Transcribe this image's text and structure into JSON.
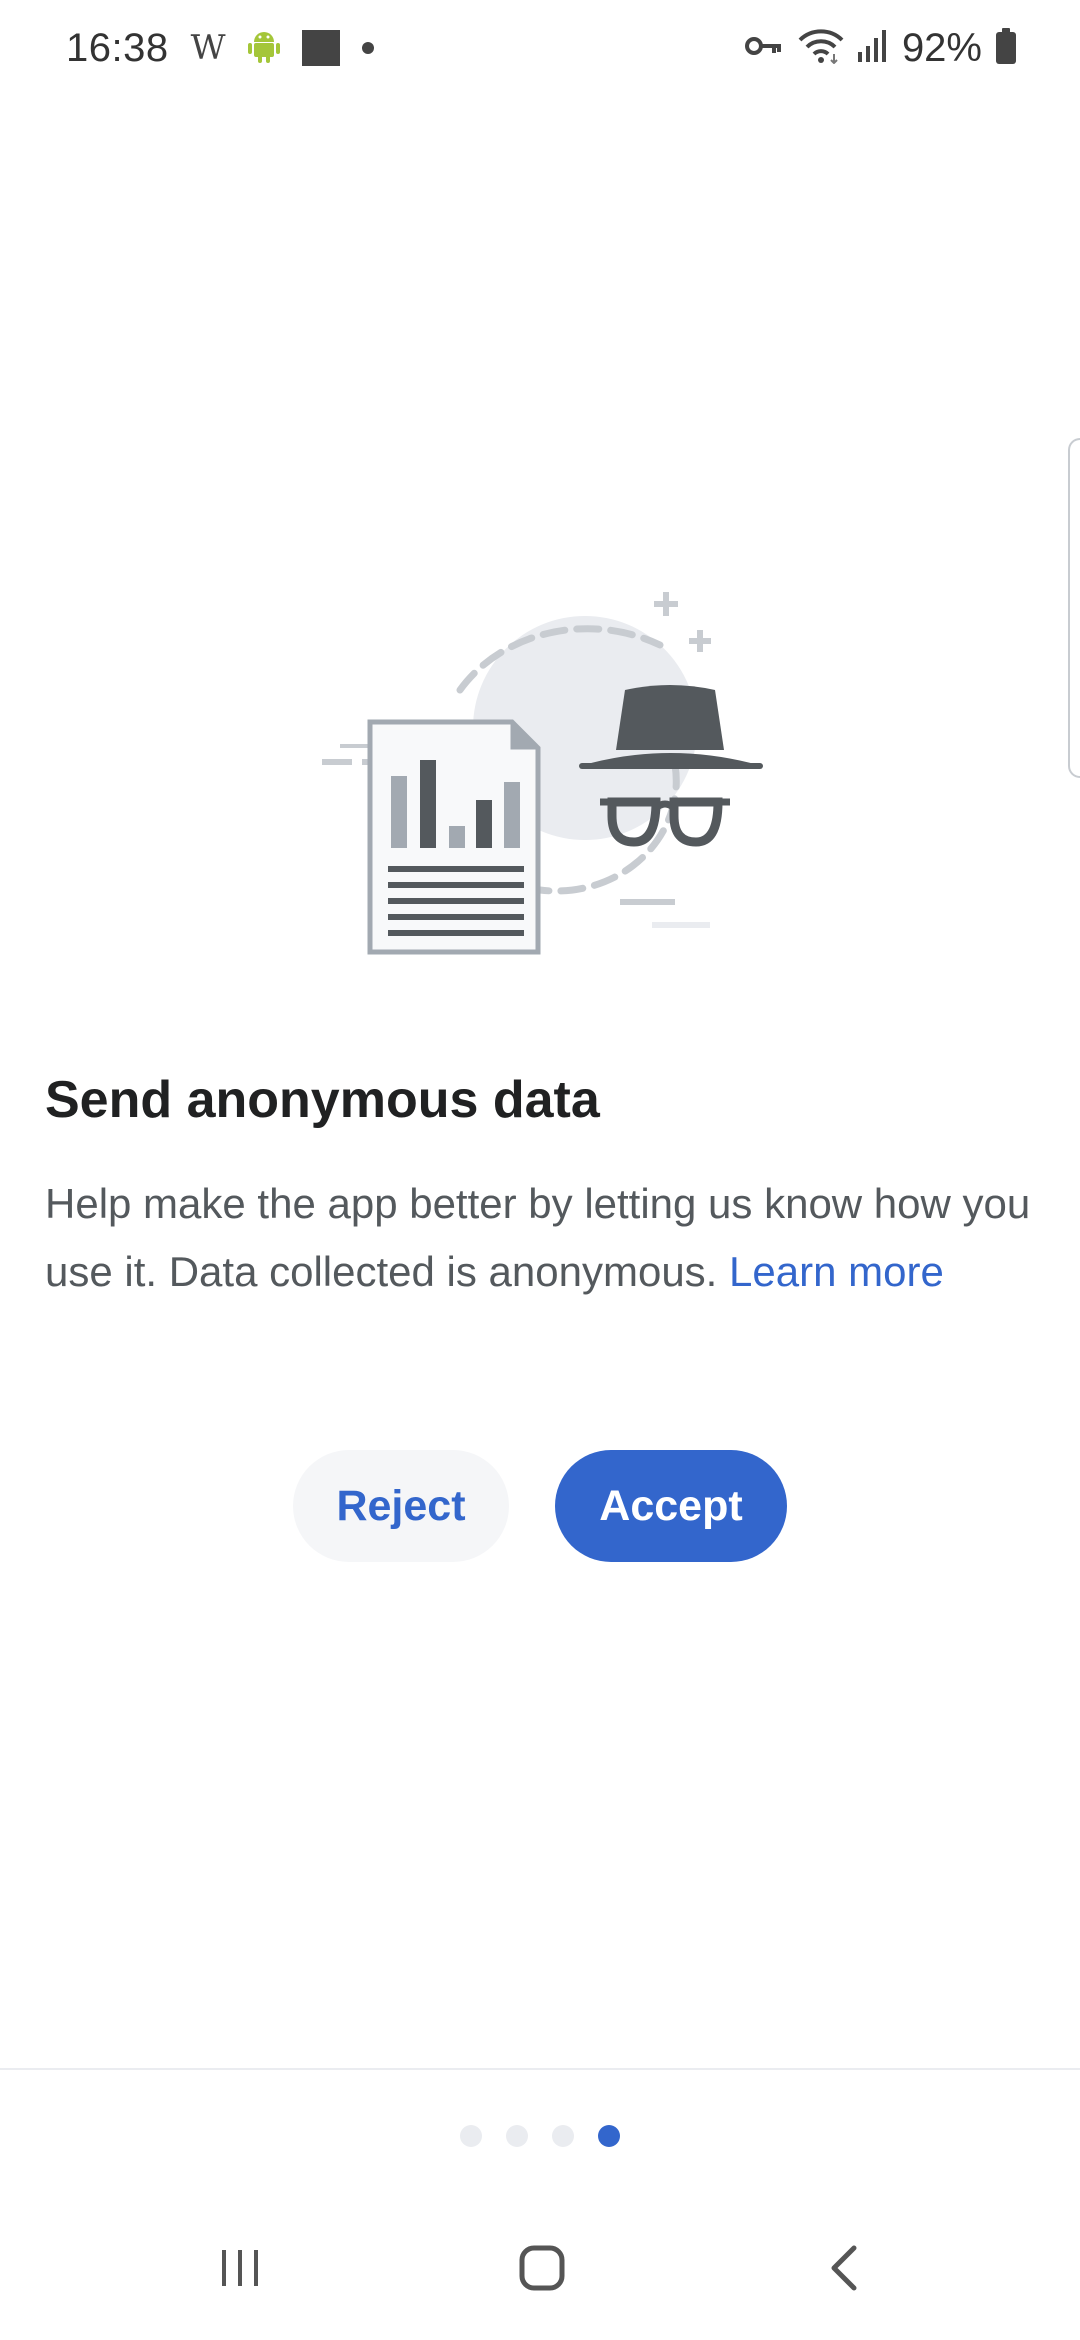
{
  "status_bar": {
    "time": "16:38",
    "w_glyph": "W",
    "battery": "92%",
    "icons": [
      "wikipedia-w-icon",
      "android-icon",
      "square-icon",
      "dot-icon",
      "vpn-key-icon",
      "wifi-icon",
      "signal-icon",
      "battery-icon"
    ]
  },
  "onboarding": {
    "title": "Send anonymous data",
    "body": "Help make the app better by letting us know how you use it. Data collected is anonymous.",
    "learn_more": "Learn more",
    "reject_label": "Reject",
    "accept_label": "Accept",
    "page_indicator": {
      "total": 4,
      "active": 4
    }
  },
  "navigation": {
    "icons": [
      "recents-icon",
      "home-icon",
      "back-icon"
    ]
  },
  "colors": {
    "accent": "#3366cc",
    "title": "#202122",
    "body": "#54595d",
    "illustration_dark": "#54595d",
    "illustration_light": "#c8ccd1"
  }
}
